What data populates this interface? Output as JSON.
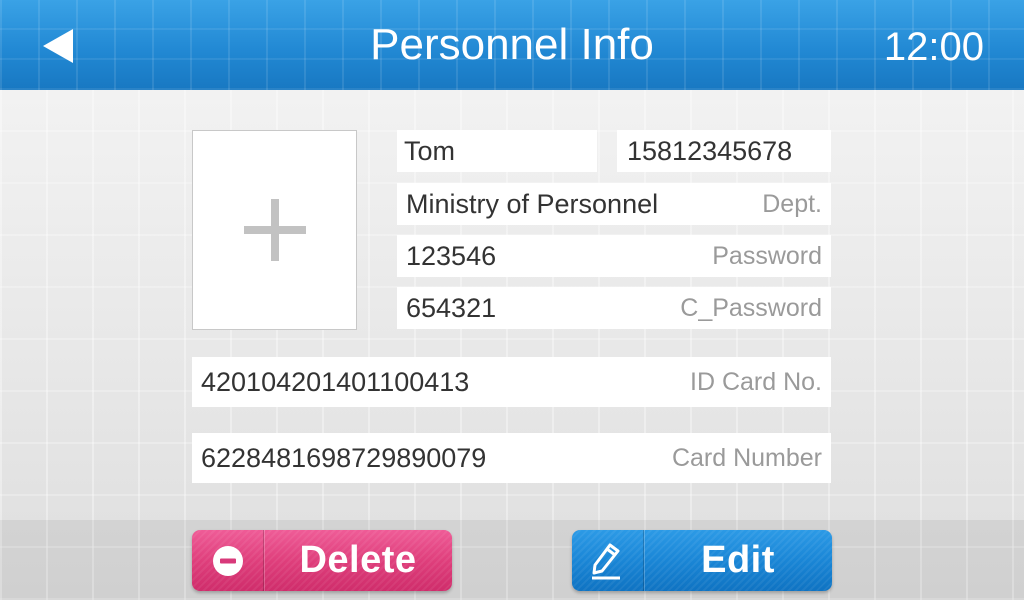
{
  "header": {
    "title": "Personnel Info",
    "time": "12:00",
    "back_icon": "back-arrow-icon"
  },
  "photo": {
    "icon": "plus-icon"
  },
  "fields": {
    "name": {
      "value": "Tom"
    },
    "phone": {
      "value": "15812345678"
    },
    "dept": {
      "value": "Ministry of Personnel",
      "label": "Dept."
    },
    "password": {
      "value": "123546",
      "label": "Password"
    },
    "confirm_password": {
      "value": "654321",
      "label": "C_Password"
    },
    "id_card": {
      "value": "420104201401100413",
      "label": "ID Card No."
    },
    "card_number": {
      "value": "6228481698729890079",
      "label": "Card Number"
    }
  },
  "buttons": {
    "delete": {
      "label": "Delete",
      "icon": "minus-circle-icon"
    },
    "edit": {
      "label": "Edit",
      "icon": "pencil-icon"
    }
  },
  "colors": {
    "header": "#2289d4",
    "delete": "#df3f7c",
    "edit": "#1a86d6"
  }
}
